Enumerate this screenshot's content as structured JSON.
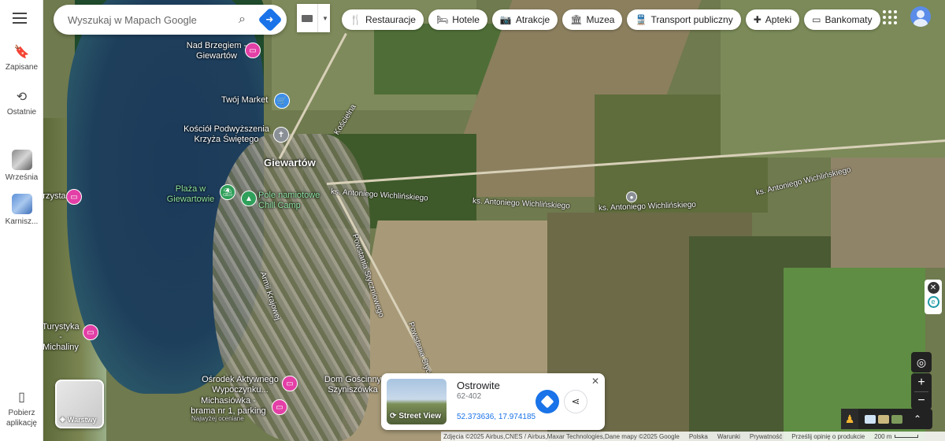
{
  "rail": {
    "items": [
      {
        "label": "Zapisane",
        "icon": "bookmark-icon"
      },
      {
        "label": "Ostatnie",
        "icon": "history-icon"
      },
      {
        "label": "Września",
        "icon": "place-thumbnail"
      },
      {
        "label": "Karnisz...",
        "icon": "place-thumbnail"
      },
      {
        "label": "Pobierz aplikację",
        "icon": "phone-icon"
      }
    ]
  },
  "search": {
    "placeholder": "Wyszukaj w Mapach Google"
  },
  "chips": [
    {
      "label": "Restauracje",
      "icon": "🍴"
    },
    {
      "label": "Hotele",
      "icon": "🛏"
    },
    {
      "label": "Atrakcje",
      "icon": "📷"
    },
    {
      "label": "Muzea",
      "icon": "🏛"
    },
    {
      "label": "Transport publiczny",
      "icon": "🚆"
    },
    {
      "label": "Apteki",
      "icon": "✚"
    },
    {
      "label": "Bankomaty",
      "icon": "▭"
    }
  ],
  "map_labels": {
    "nad_brzegiem": "Nad Brzegiem - Giewartów",
    "twoj_market": "Twój Market",
    "kosciol": "Kościół Podwyższenia Krzyża Świętego",
    "giewartow": "Giewartów",
    "plaza": "Plaża w Giewartowie",
    "pole_namiotowe": "Pole namiotowe Chill Camp",
    "road_1": "ks. Antoniego Wichlińskiego",
    "road_2": "ks. Antoniego Wichlińskiego",
    "road_3": "ks. Antoniego Wichlińskiego",
    "road_4": "ks. Antoniego Wichlińskiego",
    "koscielna": "Kościelna",
    "powstania": "Powstania Styczniowego",
    "powstania_2": "Powstania Styczniowego",
    "armii": "Armii Krajowej",
    "przystan": "Przystań",
    "turystyka": "Turystyka - Michaliny",
    "osrodek": "Ośrodek Aktywnego Wypoczynku...",
    "michasiowka": "Michasiówka - brama nr 1, parking",
    "michasiowka_sub": "Najwyżej oceniane",
    "dom_goscinny": "Dom Gościnny Szyniszówka"
  },
  "layers": {
    "label": "Warstwy"
  },
  "card": {
    "title": "Ostrowite",
    "subtitle": "62-402",
    "coords": "52.373636, 17.974185",
    "street_view_label": "Street View"
  },
  "footer": {
    "attribution": "Zdjęcia ©2025 Airbus,CNES / Airbus,Maxar Technologies,Dane mapy ©2025 Google",
    "links": [
      "Polska",
      "Warunki",
      "Prywatność",
      "Prześlij opinię o produkcie"
    ],
    "scale": "200 m"
  },
  "colors": {
    "accent": "#1a73e8",
    "poi_pink": "#e33fa6",
    "poi_blue": "#3c8ee6"
  }
}
